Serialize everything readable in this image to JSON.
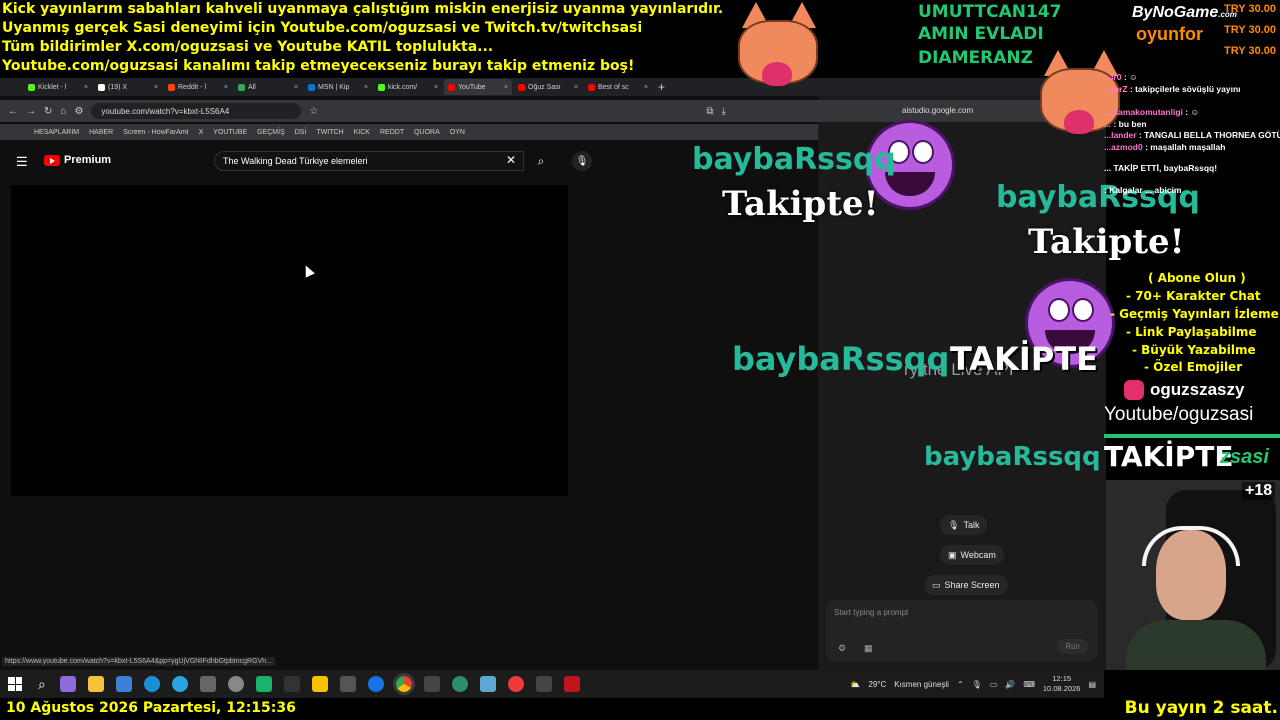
{
  "banners": [
    "Kick yayınlarım sabahları kahveli uyanmaya çalıştığım miskin enerjisiz uyanma yayınlarıdır.",
    "Uyanmış gerçek Sasi deneyimi için Youtube.com/oguzsasi ve Twitch.tv/twitchsasi",
    "Tüm bildirimler X.com/oguzsasi ve Youtube KATIL topluluktа...",
    "Youtube.com/oguzsasi kanalımı takip etmeyeceкseniz burayı takip etmeniz boş!"
  ],
  "sub_alert": {
    "line1": "UMUTTCAN147",
    "line2": "AMIN EVLADI",
    "line3": "DIAMERANZ"
  },
  "sponsor": {
    "brand": "ByNoGame",
    "brand_suffix": ".com",
    "sub": "oyunfor",
    "prices": [
      "TRY 30.00",
      "TRY 30.00",
      "TRY 30.00"
    ]
  },
  "browser": {
    "tabs": [
      {
        "label": "Kicklet - l",
        "color": "#53fc18",
        "active": false
      },
      {
        "label": "(19) X",
        "color": "#ffffff",
        "active": false
      },
      {
        "label": "Reddit - l",
        "color": "#ff4500",
        "active": false
      },
      {
        "label": "All",
        "color": "#34a853",
        "active": false
      },
      {
        "label": "MSN | Kip",
        "color": "#0078d4",
        "active": false
      },
      {
        "label": "kick.com/",
        "color": "#53fc18",
        "active": false
      },
      {
        "label": "YouTube",
        "color": "#ff0000",
        "active": true
      },
      {
        "label": "Oğuz Sası",
        "color": "#ff0000",
        "active": false
      },
      {
        "label": "Best of sc",
        "color": "#ff0000",
        "active": false
      }
    ],
    "url": "youtube.com/watch?v=kbxt-L5S6A4",
    "bookmarks": [
      "HESAPLARIM",
      "HABER",
      "Screen - HowFarAmI",
      "X",
      "YOUTUBE",
      "GEÇMİŞ",
      "DSİ",
      "TWITCH",
      "KICK",
      "REDDT",
      "QUORA",
      "OYN"
    ],
    "status_url": "https://www.youtube.com/watch?v=kbxt-L5S6A4&pp=ygUjVGhlIFdhbGtpbmcgRGVh..."
  },
  "youtube": {
    "brand": "Premium",
    "search_value": "The Walking Dead Türkiye elemeleri"
  },
  "aistudio": {
    "tab_url": "aistudio.google.com",
    "live_text": "ry the Live API",
    "talk": "Talk",
    "webcam": "Webcam",
    "share": "Share Screen",
    "placeholder": "Start typing a prompt",
    "run": "Run"
  },
  "follow_alerts": {
    "user": "baybaRssqq",
    "label_serif": "Takipte!",
    "label_caps": "TAKİPTE"
  },
  "chat": [
    {
      "user": "...ir0",
      "msg": ": ☺"
    },
    {
      "user": "...torZ",
      "msg": ": takipçilerle sövüşlü yayını"
    },
    {
      "user": "...clamakomutanligi",
      "msg": ": ☺"
    },
    {
      "user": "...",
      "msg": ": bu ben"
    },
    {
      "user": "...lander",
      "msg": ": TANGALI BELLA THORNEA GÖTÜNE NE DERSİN ŞASI"
    },
    {
      "user": "...azmod0",
      "msg": ": maşallah maşallah"
    },
    {
      "user": "",
      "msg": "... TAKİP ETTİ, baybaRssqq!"
    },
    {
      "user": "",
      "msg": ": Kalgalar ... abicim"
    }
  ],
  "promo": {
    "title": "( Abone Olun )",
    "items": [
      "- 70+ Karakter Chat",
      "- Geçmiş Yayınları İzleme",
      "- Link Paylaşabilme",
      "- Büyük Yazabilme",
      "- Özel Emojiler"
    ]
  },
  "social": {
    "instagram": "oguzszaszy",
    "youtube": "Youtube/oguzsasi",
    "twitch_tail": "zsasi"
  },
  "webcam_badge": "+18",
  "taskbar": {
    "weather": "29°C",
    "weather_desc": "Kısmen güneşli",
    "time": "12:15",
    "date": "10.08.2026"
  },
  "bottom": {
    "datetime": "10 Ağustos 2026 Pazartesi, 12:15:36",
    "ticker": "Bu yayın 2 saat."
  }
}
